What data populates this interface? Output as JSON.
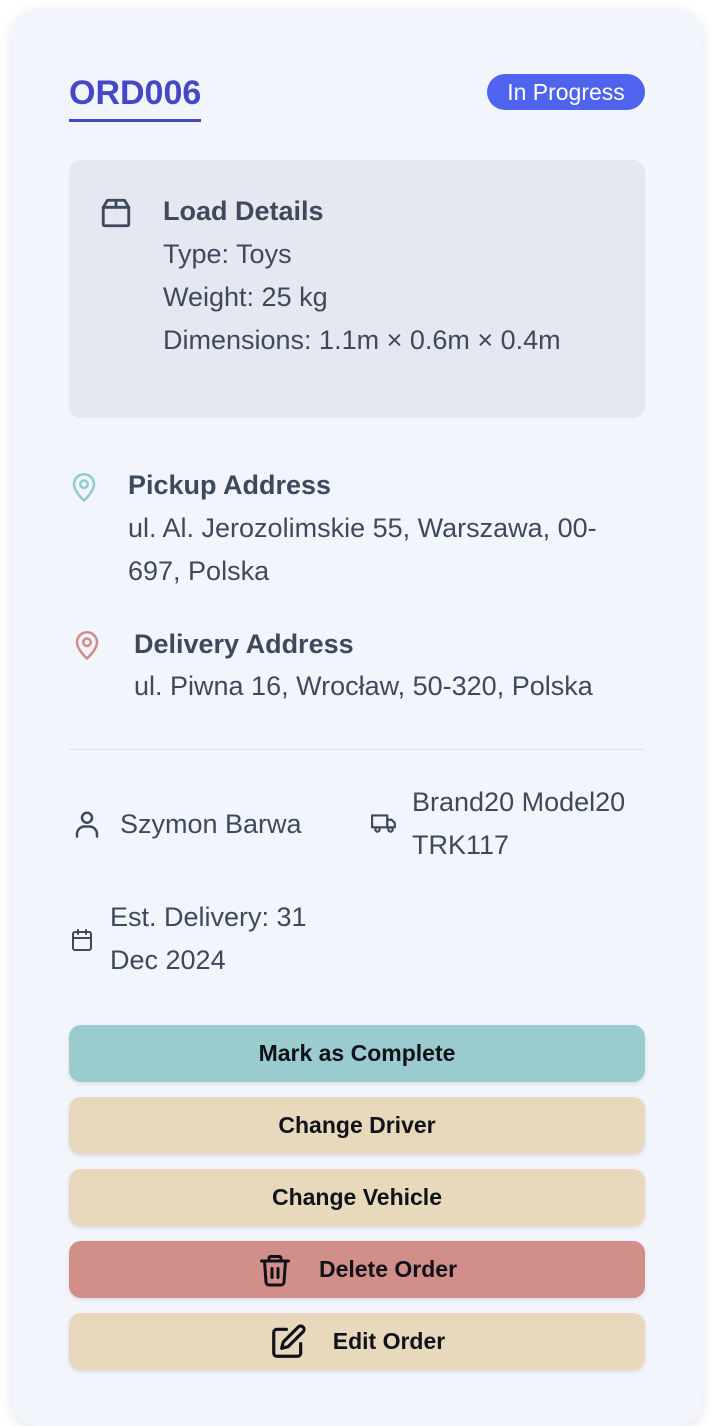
{
  "order": {
    "id": "ORD006",
    "status": "In Progress",
    "status_color": "#4f64ee",
    "accent_color": "#4448c7"
  },
  "load": {
    "icon": "package-icon",
    "title": "Load Details",
    "type": "Type: Toys",
    "weight": "Weight: 25 kg",
    "dimensions": "Dimensions: 1.1m × 0.6m × 0.4m"
  },
  "pickup": {
    "icon": "map-pin-icon",
    "icon_color": "#92cbcb",
    "title": "Pickup Address",
    "address": "ul. Al. Jerozolimskie 55, Warszawa, 00-697, Polska"
  },
  "delivery": {
    "icon": "map-pin-icon",
    "icon_color": "#d08c87",
    "title": "Delivery Address",
    "address": "ul. Piwna 16, Wrocław, 50-320, Polska"
  },
  "driver": {
    "icon": "user-icon",
    "name": "Szymon Barwa"
  },
  "vehicle": {
    "icon": "truck-icon",
    "model": "Brand20 Model20",
    "plate": "TRK117"
  },
  "estimate": {
    "icon": "calendar-icon",
    "text": "Est. Delivery: 31 Dec 2024"
  },
  "actions": {
    "complete": {
      "label": "Mark as Complete",
      "color": "#9acbcf"
    },
    "change_driver": {
      "label": "Change Driver",
      "color": "#e8d8bc"
    },
    "change_vehicle": {
      "label": "Change Vehicle",
      "color": "#e8d8bc"
    },
    "delete": {
      "label": "Delete Order",
      "icon": "trash-icon",
      "color": "#d28e89"
    },
    "edit": {
      "label": "Edit Order",
      "icon": "edit-icon",
      "color": "#e8d8bc"
    }
  }
}
